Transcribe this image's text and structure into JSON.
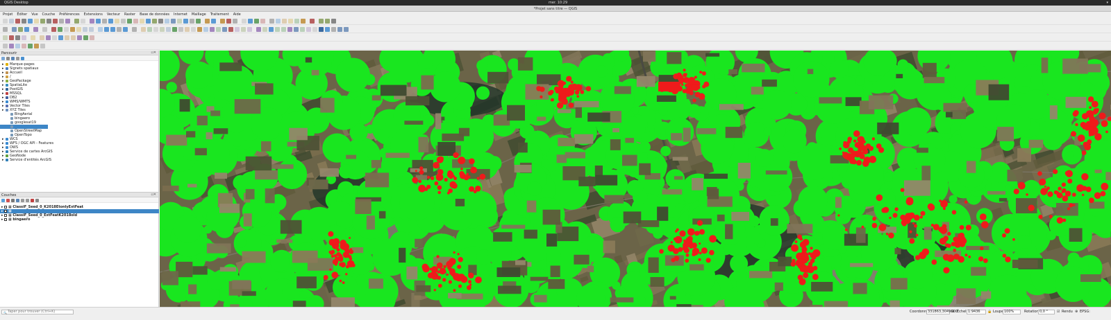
{
  "system": {
    "app_name": "QGIS Desktop",
    "clock": "mer. 10:29"
  },
  "window": {
    "title": "*Projet sans titre — QGIS"
  },
  "menu": [
    "Projet",
    "Éditer",
    "Vue",
    "Couche",
    "Préférences",
    "Extensions",
    "Vecteur",
    "Raster",
    "Base de données",
    "Internet",
    "Maillage",
    "Traitement",
    "Aide"
  ],
  "browser": {
    "title": "Parcourir",
    "items": [
      {
        "label": "Marque-pages",
        "indent": 1,
        "icon": "star-icon",
        "color": "#e0b000"
      },
      {
        "label": "Signets spatiaux",
        "indent": 1,
        "icon": "bookmark-icon",
        "color": "#4a7fc0"
      },
      {
        "label": "Accueil",
        "indent": 1,
        "icon": "home-icon",
        "color": "#c09050"
      },
      {
        "label": "/",
        "indent": 1,
        "icon": "folder-icon",
        "color": "#d0a040"
      },
      {
        "label": "GeoPackage",
        "indent": 1,
        "icon": "geopackage-icon",
        "color": "#8ab040"
      },
      {
        "label": "SpatiaLite",
        "indent": 1,
        "icon": "spatialite-icon",
        "color": "#3a90c0"
      },
      {
        "label": "PostGIS",
        "indent": 1,
        "icon": "postgis-icon",
        "color": "#336699"
      },
      {
        "label": "MSSQL",
        "indent": 1,
        "icon": "mssql-icon",
        "color": "#c04040"
      },
      {
        "label": "DB2",
        "indent": 1,
        "icon": "db2-icon",
        "color": "#4060a0"
      },
      {
        "label": "WMS/WMTS",
        "indent": 1,
        "icon": "wms-icon",
        "color": "#3a8ad0"
      },
      {
        "label": "Vector Tiles",
        "indent": 1,
        "icon": "vector-tiles-icon",
        "color": "#5a70b0"
      },
      {
        "label": "XYZ Tiles",
        "indent": 1,
        "icon": "xyz-tiles-icon",
        "color": "#6a90c0"
      },
      {
        "label": "BingAerial",
        "indent": 2,
        "icon": "tile-icon",
        "color": "#7a9ab8"
      },
      {
        "label": "bingaero",
        "indent": 2,
        "icon": "tile-icon",
        "color": "#7a9ab8"
      },
      {
        "label": "googlesat19",
        "indent": 2,
        "icon": "tile-icon",
        "color": "#7a9ab8"
      },
      {
        "label": "",
        "indent": 2,
        "icon": "tile-icon",
        "color": "#7a9ab8",
        "selected": true
      },
      {
        "label": "OpenStreetMap",
        "indent": 2,
        "icon": "tile-icon",
        "color": "#7a9ab8"
      },
      {
        "label": "OpenTopo",
        "indent": 2,
        "icon": "tile-icon",
        "color": "#7a9ab8"
      },
      {
        "label": "WCS",
        "indent": 1,
        "icon": "wcs-icon",
        "color": "#3a8ad0"
      },
      {
        "label": "WFS / OGC API - Features",
        "indent": 1,
        "icon": "wfs-icon",
        "color": "#3a8ad0"
      },
      {
        "label": "OWS",
        "indent": 1,
        "icon": "ows-icon",
        "color": "#3a8ad0"
      },
      {
        "label": "Service de cartes ArcGIS",
        "indent": 1,
        "icon": "arcgis-map-icon",
        "color": "#2f7fb8"
      },
      {
        "label": "GeoNode",
        "indent": 1,
        "icon": "geonode-icon",
        "color": "#60a040"
      },
      {
        "label": "Service d'entités ArcGIS",
        "indent": 1,
        "icon": "arcgis-feature-icon",
        "color": "#2f7fb8"
      }
    ]
  },
  "layers": {
    "title": "Couches",
    "items": [
      {
        "label": "ClassiF_Seed_0_K2018EtonlyExtFeat",
        "selected": false
      },
      {
        "label": "",
        "selected": true
      },
      {
        "label": "ClassiF_Seed_0_ExtFeatK2018old",
        "selected": false
      },
      {
        "label": "bingaero",
        "selected": false
      }
    ]
  },
  "status": {
    "locator_placeholder": "Taper pour trouver (Ctrl+K)",
    "coord_label": "Coordonnée",
    "coord_value": "331863,3049000",
    "scale_label": "Échelle",
    "scale_value": "1:9436",
    "magnifier_label": "Loupe",
    "magnifier_value": "100%",
    "rotation_label": "Rotation",
    "rotation_value": "0,0 °",
    "render_label": "Rendu",
    "crs_label": "EPSG:"
  }
}
